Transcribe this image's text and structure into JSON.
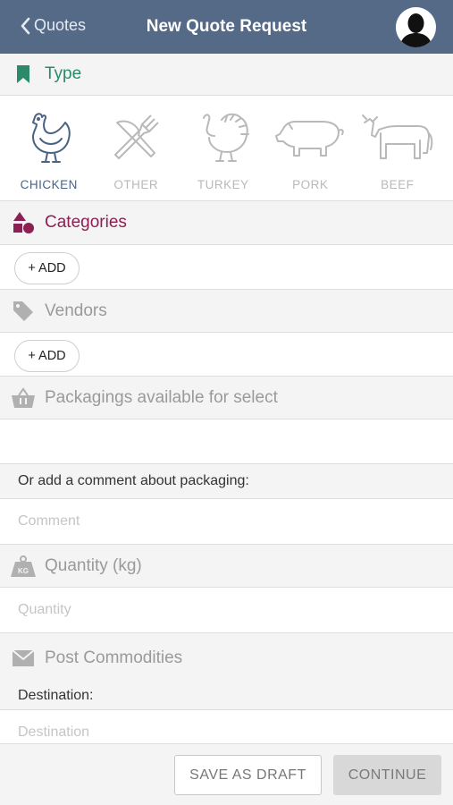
{
  "nav": {
    "back_label": "Quotes",
    "title": "New Quote Request"
  },
  "type_section": {
    "label": "Type",
    "items": [
      {
        "label": "CHICKEN",
        "icon": "chicken-icon",
        "selected": true
      },
      {
        "label": "OTHER",
        "icon": "fork-knife-icon",
        "selected": false
      },
      {
        "label": "TURKEY",
        "icon": "turkey-icon",
        "selected": false
      },
      {
        "label": "PORK",
        "icon": "pig-icon",
        "selected": false
      },
      {
        "label": "BEEF",
        "icon": "cow-icon",
        "selected": false
      }
    ]
  },
  "categories": {
    "label": "Categories",
    "add_label": "+ ADD"
  },
  "vendors": {
    "label": "Vendors",
    "add_label": "+ ADD"
  },
  "packagings": {
    "label": "Packagings available for select",
    "comment_prompt": "Or add a comment about packaging:",
    "comment_placeholder": "Comment"
  },
  "quantity": {
    "label": "Quantity (kg)",
    "placeholder": "Quantity",
    "badge": "KG"
  },
  "post": {
    "label": "Post Commodities",
    "destination_label": "Destination:",
    "destination_placeholder": "Destination"
  },
  "footer": {
    "draft_label": "SAVE AS DRAFT",
    "continue_label": "CONTINUE"
  },
  "colors": {
    "navbar": "#546a86",
    "type_accent": "#2a8a6a",
    "categories_accent": "#8c1f54",
    "muted": "#b0b0b0",
    "selected_type": "#4a6382"
  }
}
